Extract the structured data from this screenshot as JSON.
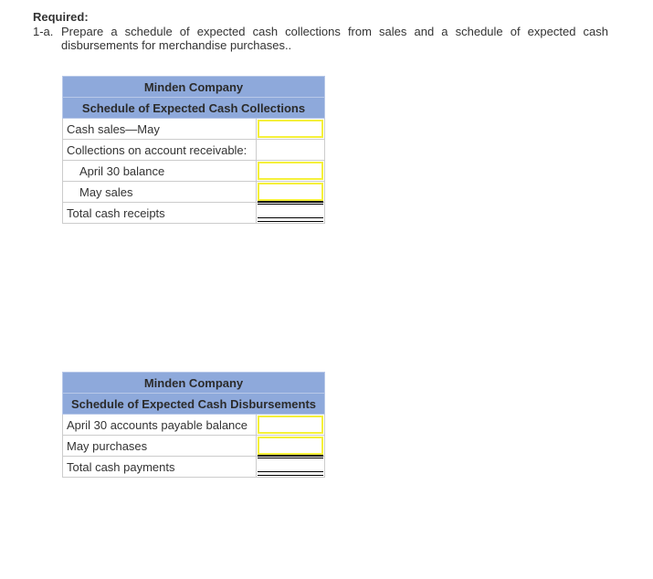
{
  "required": {
    "heading": "Required:",
    "item_number": "1-a.",
    "item_text": "Prepare a schedule of expected cash collections from sales and a schedule of expected cash disbursements for merchandise purchases.."
  },
  "collections": {
    "company": "Minden Company",
    "title": "Schedule of Expected Cash Collections",
    "rows": [
      {
        "label": "Cash sales—May",
        "value": ""
      },
      {
        "label": "Collections on account receivable:"
      },
      {
        "label": "April 30 balance",
        "value": ""
      },
      {
        "label": "May sales",
        "value": ""
      },
      {
        "label": "Total cash receipts",
        "value": ""
      }
    ]
  },
  "disbursements": {
    "company": "Minden Company",
    "title": "Schedule of Expected Cash Disbursements",
    "rows": [
      {
        "label": "April 30 accounts payable balance",
        "value": ""
      },
      {
        "label": "May purchases",
        "value": ""
      },
      {
        "label": "Total cash payments",
        "value": ""
      }
    ]
  },
  "colors": {
    "header_bg": "#8ea9db",
    "input_border": "#f5f03a"
  }
}
